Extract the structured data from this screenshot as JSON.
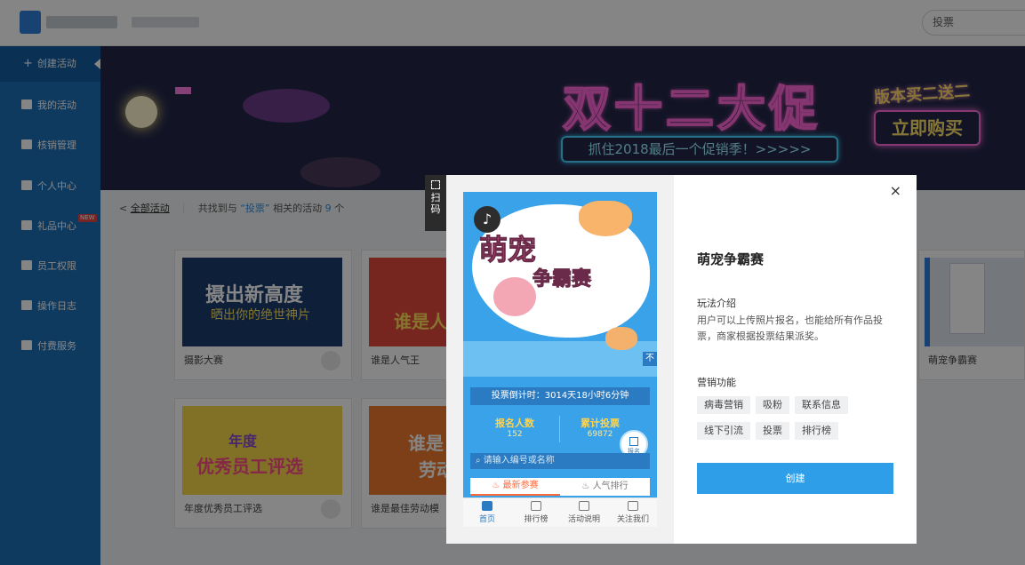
{
  "header": {
    "search_placeholder": "投票"
  },
  "sidebar": {
    "items": [
      {
        "label": "创建活动",
        "icon": "plus-icon",
        "active": true
      },
      {
        "label": "我的活动",
        "icon": "list-icon"
      },
      {
        "label": "核销管理",
        "icon": "ticket-icon"
      },
      {
        "label": "个人中心",
        "icon": "user-icon"
      },
      {
        "label": "礼品中心",
        "icon": "gift-icon",
        "badge": "NEW"
      },
      {
        "label": "员工权限",
        "icon": "lock-icon"
      },
      {
        "label": "操作日志",
        "icon": "log-icon"
      },
      {
        "label": "付费服务",
        "icon": "payment-icon"
      }
    ]
  },
  "banner": {
    "title": "双十二大促",
    "subtitle": "抓住2018最后一个促销季！>>>>>",
    "badge": "版本买二送二",
    "buy_label": "立即购买"
  },
  "breadcrumb": {
    "back": "全部活动",
    "prefix": "共找到与",
    "keyword": "“投票”",
    "suffix": "相关的活动",
    "count": "9",
    "unit": "个"
  },
  "cards": [
    {
      "name": "摄影大赛",
      "thumb_text": "摄出新高度",
      "thumb_sub": "晒出你的绝世神片"
    },
    {
      "name": "谁是人气王",
      "thumb_text": "谁是人"
    },
    {
      "name": "年度优秀员工评选",
      "thumb_text": "优秀员工评选",
      "thumb_sub": "年度"
    },
    {
      "name": "谁是最佳劳动模",
      "thumb_text": "谁是",
      "thumb_sub": "劳动"
    },
    {
      "name": "萌宠争霸赛"
    }
  ],
  "scan_tab": {
    "label_1": "扫",
    "label_2": "码"
  },
  "modal": {
    "close": "×",
    "title": "萌宠争霸赛",
    "intro_heading": "玩法介绍",
    "intro_text": "用户可以上传照片报名，也能给所有作品投票，商家根据投票结果派奖。",
    "marketing_heading": "营销功能",
    "features": [
      "病毒营销",
      "吸粉",
      "联系信息",
      "线下引流",
      "投票",
      "排行榜"
    ],
    "create_label": "创建",
    "preview": {
      "title_1": "萌宠",
      "title_2": "争霸赛",
      "corner": "不",
      "countdown": "投票倒计时：3014天18小时6分钟",
      "stat_1_label": "报名人数",
      "stat_1_value": "152",
      "stat_2_label": "累计投票",
      "stat_2_value": "69872",
      "signup_label": "报名",
      "search_placeholder": "请输入编号或名称",
      "tab_latest": "最新参赛",
      "tab_popular": "人气排行",
      "nav": [
        "首页",
        "排行榜",
        "活动说明",
        "关注我们"
      ]
    }
  },
  "colors": {
    "sidebar": "#1d6fb8",
    "primary": "#2f9ee8",
    "overlay": "rgba(0,0,0,0.48)"
  }
}
